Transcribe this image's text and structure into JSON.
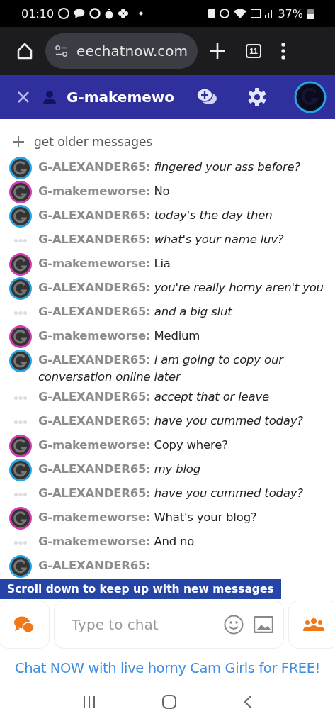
{
  "status_bar": {
    "time": "01:10",
    "battery": "37%"
  },
  "browser": {
    "url": "eechatnow.com",
    "tab_count": "11"
  },
  "header": {
    "title": "G-makemewo"
  },
  "chat": {
    "older_link": "get older messages",
    "messages": [
      {
        "kind": "avatar",
        "color": "#2aa4e0",
        "user": "G-ALEXANDER65:",
        "text": "fingered your ass before?",
        "italic": true
      },
      {
        "kind": "avatar",
        "color": "#d23cb2",
        "user": "G-makemeworse:",
        "text": "No",
        "italic": false
      },
      {
        "kind": "avatar",
        "color": "#2aa4e0",
        "user": "G-ALEXANDER65:",
        "text": "today's the day then",
        "italic": true
      },
      {
        "kind": "dots",
        "user": "G-ALEXANDER65:",
        "text": "what's your name luv?",
        "italic": true
      },
      {
        "kind": "avatar",
        "color": "#d23cb2",
        "user": "G-makemeworse:",
        "text": "Lia",
        "italic": false
      },
      {
        "kind": "avatar",
        "color": "#2aa4e0",
        "user": "G-ALEXANDER65:",
        "text": "you're really horny aren't you",
        "italic": true
      },
      {
        "kind": "dots",
        "user": "G-ALEXANDER65:",
        "text": "and a big slut",
        "italic": true
      },
      {
        "kind": "avatar",
        "color": "#d23cb2",
        "user": "G-makemeworse:",
        "text": "Medium",
        "italic": false
      },
      {
        "kind": "avatar",
        "color": "#2aa4e0",
        "user": "G-ALEXANDER65:",
        "text": "i am going to copy our conversation online later",
        "italic": true
      },
      {
        "kind": "dots",
        "user": "G-ALEXANDER65:",
        "text": "accept that or leave",
        "italic": true
      },
      {
        "kind": "dots",
        "user": "G-ALEXANDER65:",
        "text": "have you cummed today?",
        "italic": true
      },
      {
        "kind": "avatar",
        "color": "#d23cb2",
        "user": "G-makemeworse:",
        "text": "Copy where?",
        "italic": false
      },
      {
        "kind": "avatar",
        "color": "#2aa4e0",
        "user": "G-ALEXANDER65:",
        "text": "my blog",
        "italic": true
      },
      {
        "kind": "dots",
        "user": "G-ALEXANDER65:",
        "text": "have you cummed today?",
        "italic": true
      },
      {
        "kind": "avatar",
        "color": "#d23cb2",
        "user": "G-makemeworse:",
        "text": "What's your blog?",
        "italic": false
      },
      {
        "kind": "dots",
        "user": "G-makemeworse:",
        "text": "And no",
        "italic": false
      },
      {
        "kind": "avatar",
        "color": "#2aa4e0",
        "user": "G-ALEXANDER65:"
      }
    ],
    "scroll_notice": "Scroll down to keep up with new messages"
  },
  "composer": {
    "placeholder": "Type to chat"
  },
  "ad_link": "Chat NOW with live horny Cam Girls for FREE!"
}
